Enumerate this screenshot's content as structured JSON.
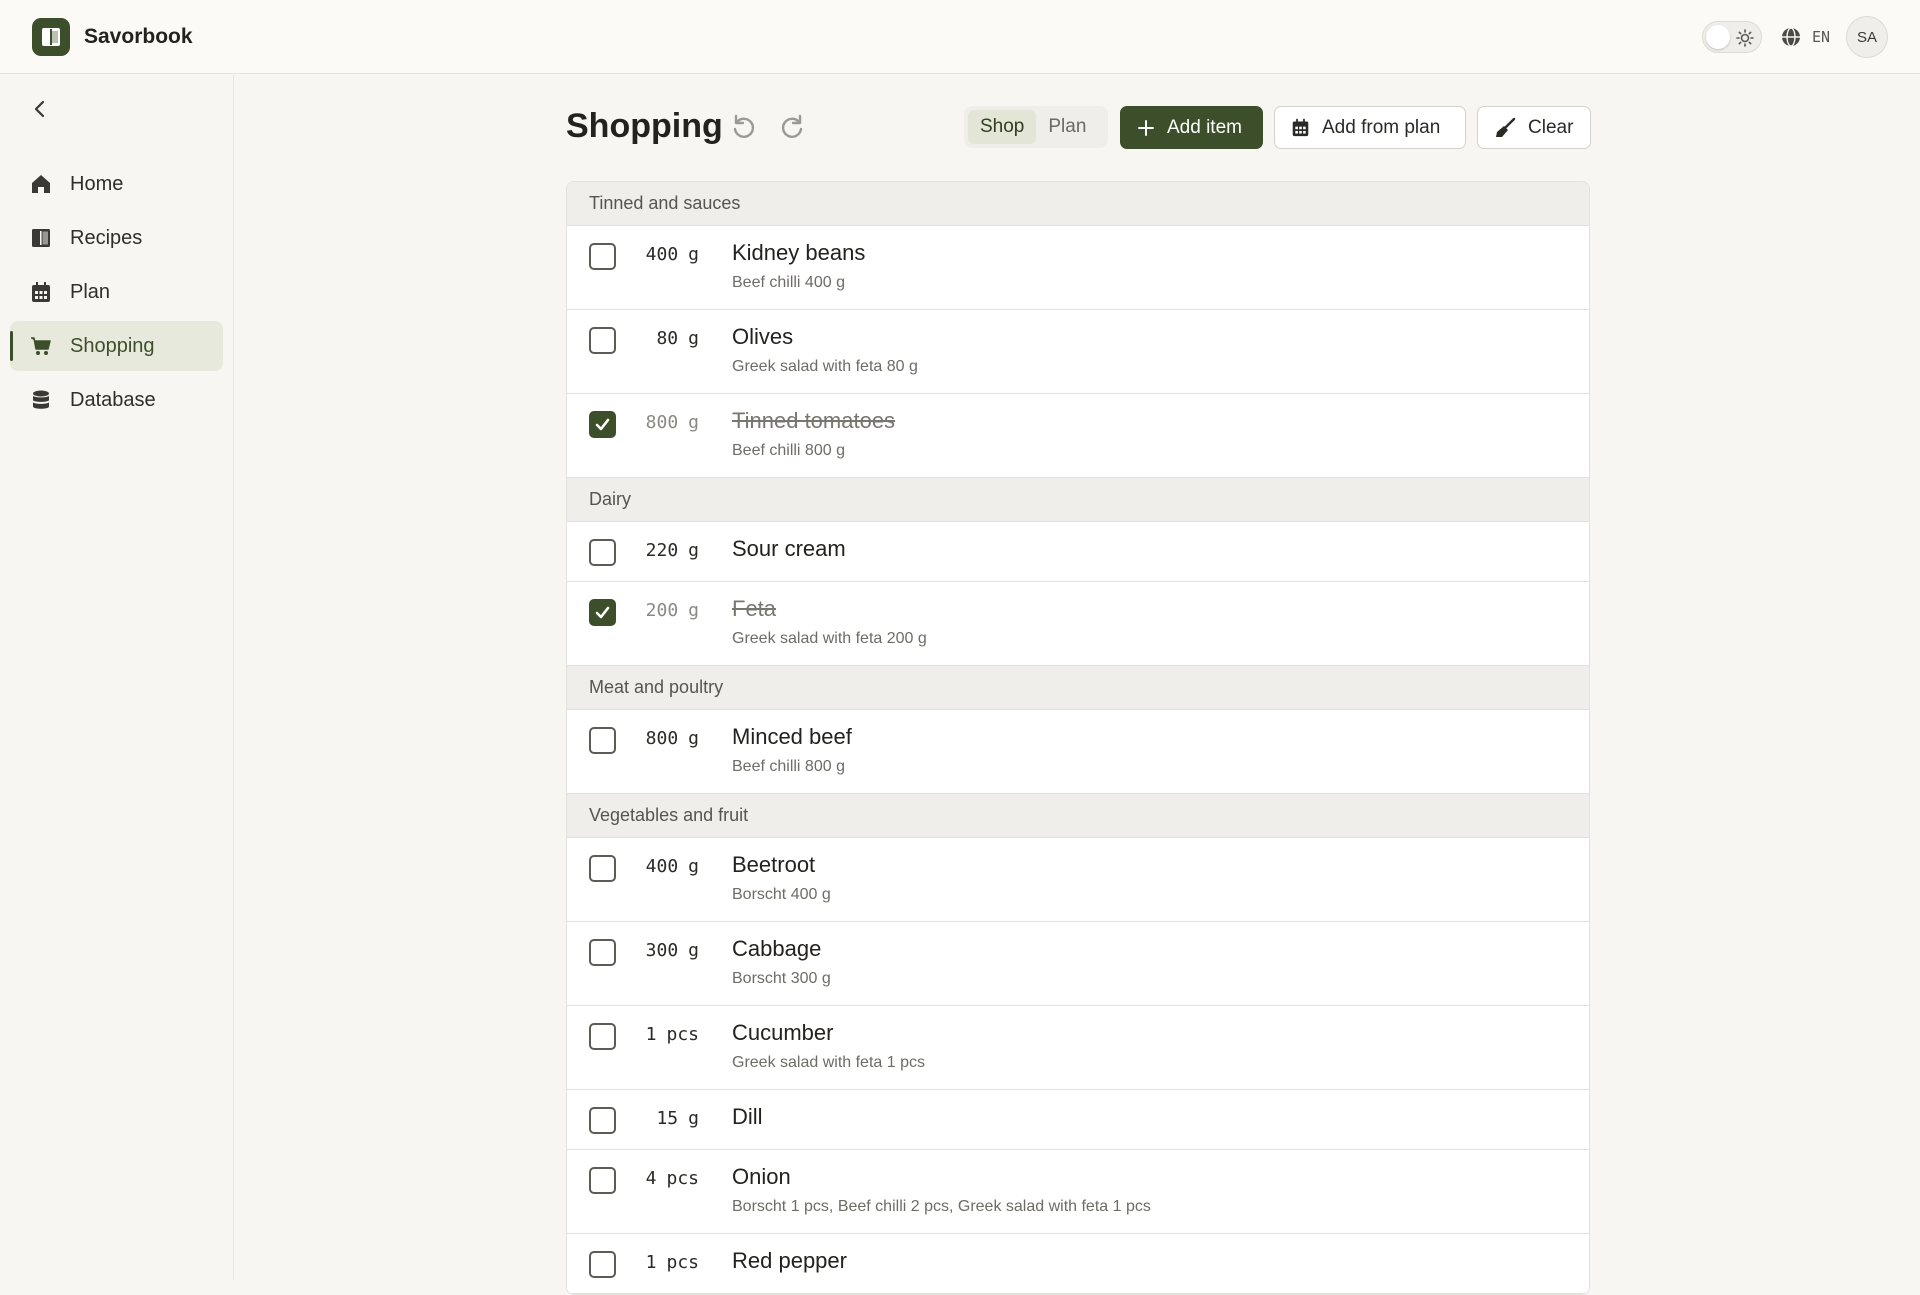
{
  "app": {
    "name": "Savorbook"
  },
  "topbar": {
    "language": "EN",
    "avatar_initials": "SA"
  },
  "sidebar": {
    "items": [
      {
        "label": "Home",
        "icon": "home-icon",
        "active": false
      },
      {
        "label": "Recipes",
        "icon": "book-icon",
        "active": false
      },
      {
        "label": "Plan",
        "icon": "calendar-icon",
        "active": false
      },
      {
        "label": "Shopping",
        "icon": "cart-icon",
        "active": true
      },
      {
        "label": "Database",
        "icon": "database-icon",
        "active": false
      }
    ]
  },
  "header": {
    "title": "Shopping",
    "segment": {
      "shop": "Shop",
      "plan": "Plan",
      "active": "Shop"
    },
    "add_item": "Add item",
    "add_from_plan": "Add from plan",
    "clear": "Clear"
  },
  "colors": {
    "accent": "#3d4f2a",
    "accent_soft": "#e6e9dc",
    "background": "#f7f6f3"
  },
  "groups": [
    {
      "name": "Tinned and sauces",
      "items": [
        {
          "qty": "400",
          "unit": "g",
          "name": "Kidney beans",
          "sub": "Beef chilli 400 g",
          "checked": false
        },
        {
          "qty": "80",
          "unit": "g",
          "name": "Olives",
          "sub": "Greek salad with feta 80 g",
          "checked": false
        },
        {
          "qty": "800",
          "unit": "g",
          "name": "Tinned tomatoes",
          "sub": "Beef chilli 800 g",
          "checked": true
        }
      ]
    },
    {
      "name": "Dairy",
      "items": [
        {
          "qty": "220",
          "unit": "g",
          "name": "Sour cream",
          "sub": "",
          "checked": false
        },
        {
          "qty": "200",
          "unit": "g",
          "name": "Feta",
          "sub": "Greek salad with feta 200 g",
          "checked": true
        }
      ]
    },
    {
      "name": "Meat and poultry",
      "items": [
        {
          "qty": "800",
          "unit": "g",
          "name": "Minced beef",
          "sub": "Beef chilli 800 g",
          "checked": false
        }
      ]
    },
    {
      "name": "Vegetables and fruit",
      "items": [
        {
          "qty": "400",
          "unit": "g",
          "name": "Beetroot",
          "sub": "Borscht 400 g",
          "checked": false
        },
        {
          "qty": "300",
          "unit": "g",
          "name": "Cabbage",
          "sub": "Borscht 300 g",
          "checked": false
        },
        {
          "qty": "1",
          "unit": "pcs",
          "name": "Cucumber",
          "sub": "Greek salad with feta 1 pcs",
          "checked": false
        },
        {
          "qty": "15",
          "unit": "g",
          "name": "Dill",
          "sub": "",
          "checked": false
        },
        {
          "qty": "4",
          "unit": "pcs",
          "name": "Onion",
          "sub": "Borscht 1 pcs, Beef chilli 2 pcs, Greek salad with feta 1 pcs",
          "checked": false
        },
        {
          "qty": "1",
          "unit": "pcs",
          "name": "Red pepper",
          "sub": "",
          "checked": false
        }
      ]
    }
  ]
}
